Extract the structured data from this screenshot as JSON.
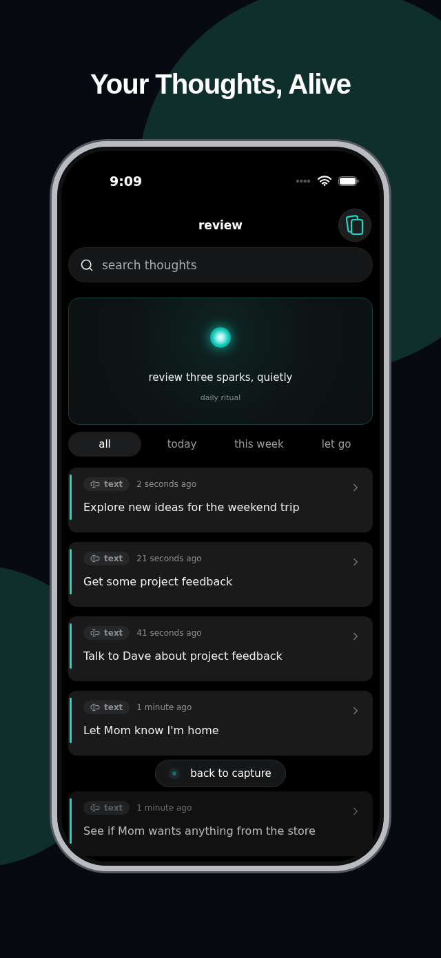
{
  "headline": "Your Thoughts, Alive",
  "status_bar": {
    "time": "9:09"
  },
  "header": {
    "title": "review"
  },
  "search": {
    "placeholder": "search thoughts"
  },
  "ritual": {
    "title": "review three sparks, quietly",
    "subtitle": "daily ritual"
  },
  "filters": [
    {
      "label": "all",
      "selected": true
    },
    {
      "label": "today",
      "selected": false
    },
    {
      "label": "this week",
      "selected": false
    },
    {
      "label": "let go",
      "selected": false
    }
  ],
  "thoughts": [
    {
      "type": "text",
      "time": "2 seconds ago",
      "text": "Explore new ideas for the weekend trip",
      "faded": false
    },
    {
      "type": "text",
      "time": "21 seconds ago",
      "text": "Get some project feedback",
      "faded": false
    },
    {
      "type": "text",
      "time": "41 seconds ago",
      "text": "Talk to Dave about project feedback",
      "faded": false
    },
    {
      "type": "text",
      "time": "1 minute ago",
      "text": "Let Mom know I'm home",
      "faded": false
    },
    {
      "type": "text",
      "time": "1 minute ago",
      "text": "See if Mom wants anything from the store",
      "faded": true
    }
  ],
  "back_button": {
    "label": "back to capture"
  }
}
